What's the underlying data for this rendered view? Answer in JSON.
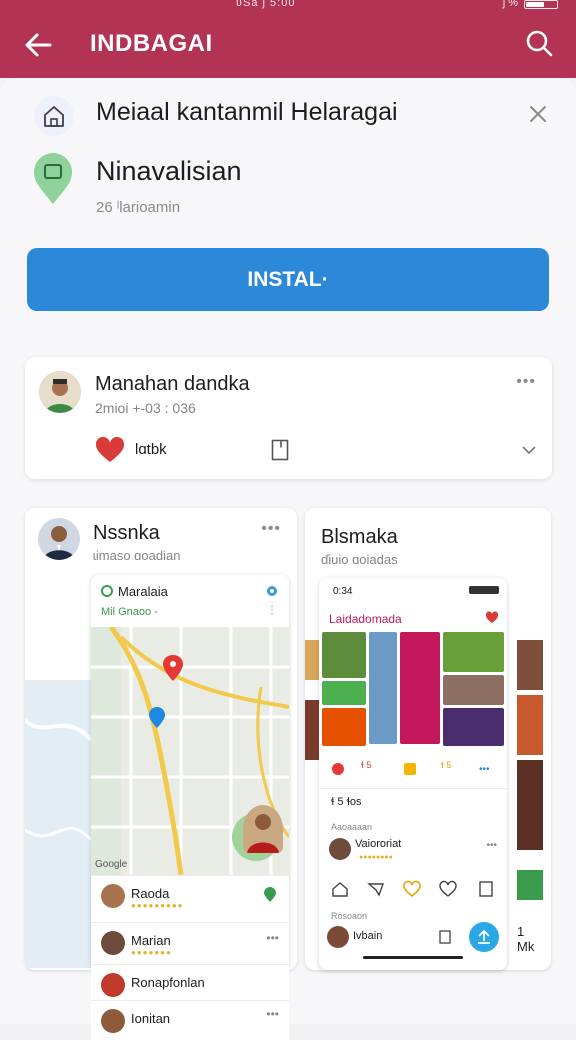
{
  "status_bar": {
    "center_text": "ʋSa ʃ 5:00",
    "battery_text": "ʃ %"
  },
  "app_bar": {
    "title": "INDBAGAI"
  },
  "header": {
    "title": "Meiaal kantanmil Helaragai",
    "subtitle": "Ninavalisian",
    "meta": "26 ˡlarioamin",
    "install_label": "INSTAL·"
  },
  "post1": {
    "name": "Manahan dandka",
    "time": "2mioi +-03 : 036",
    "like_label": "lɑtbk"
  },
  "post2": {
    "name": "Nssnka",
    "sub": "ɩimaso ɑoadian",
    "map_app": {
      "title": "Maralaia",
      "subtitle": "Mil Gnaoo -",
      "google": "Google",
      "rows": [
        {
          "label": "Raoda"
        },
        {
          "label": "Marian"
        },
        {
          "label": "Ronapfonlan"
        },
        {
          "label": "Ionitan"
        }
      ]
    }
  },
  "post3": {
    "name": "Blsmaka",
    "sub": "ɗiuio ɑoiadas",
    "phone": {
      "time": "0:34",
      "title": "Laidadomada",
      "likes": "ɬ 5",
      "saves": "ɬ 5",
      "counts_line": "ɬ 5 ɬos",
      "section_label": "Aaoaaaan",
      "comment_name": "Vaiororiat",
      "section2_label": "Rosoaon",
      "last_name": "Ivbain"
    },
    "count_label": "1 Mk"
  },
  "colors": {
    "brand": "#b23354",
    "accent": "#2c88d9",
    "heart": "#d93a3a"
  }
}
